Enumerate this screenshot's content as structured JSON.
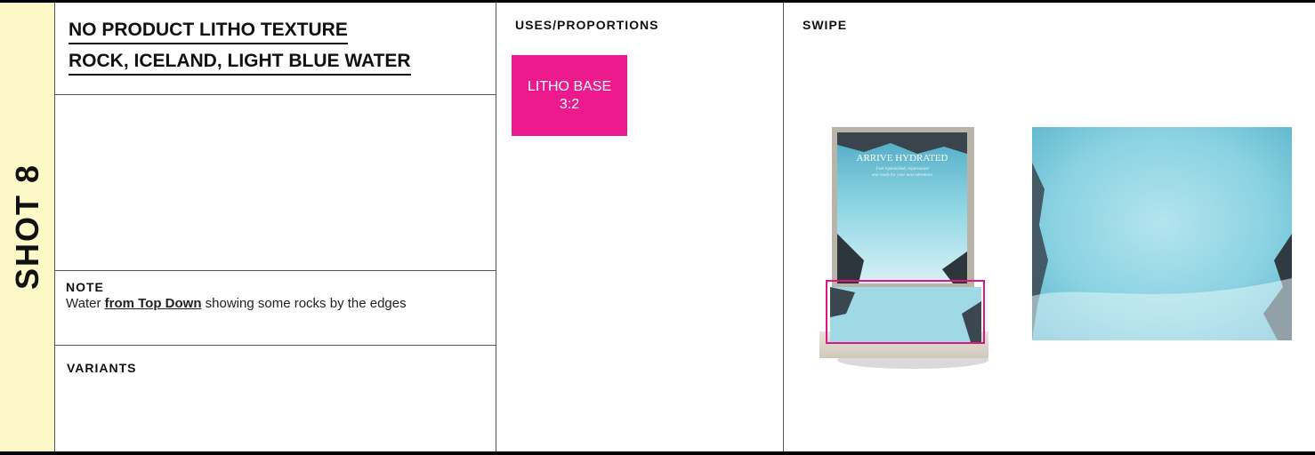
{
  "shot": {
    "label": "SHOT 8"
  },
  "title": {
    "line1": "NO PRODUCT LITHO TEXTURE",
    "line2": "ROCK, ICELAND, LIGHT BLUE WATER"
  },
  "note": {
    "label": "NOTE",
    "text_before": "Water ",
    "text_emphasis": "from Top Down",
    "text_after": " showing some rocks by the edges"
  },
  "variants": {
    "label": "VARIANTS"
  },
  "uses": {
    "label": "USES/PROPORTIONS",
    "badge_line1": "LITHO BASE",
    "badge_line2": "3:2"
  },
  "swipe": {
    "label": "SWIPE",
    "display_headline": "ARRIVE HYDRATED",
    "display_subline1": "Feel replenished, rejuvenated",
    "display_subline2": "and ready for your next adventure"
  },
  "colors": {
    "shot_band": "#fdf8c8",
    "badge": "#ec1a8d",
    "water": "#8fd6e4",
    "highlight": "#e0157f"
  }
}
